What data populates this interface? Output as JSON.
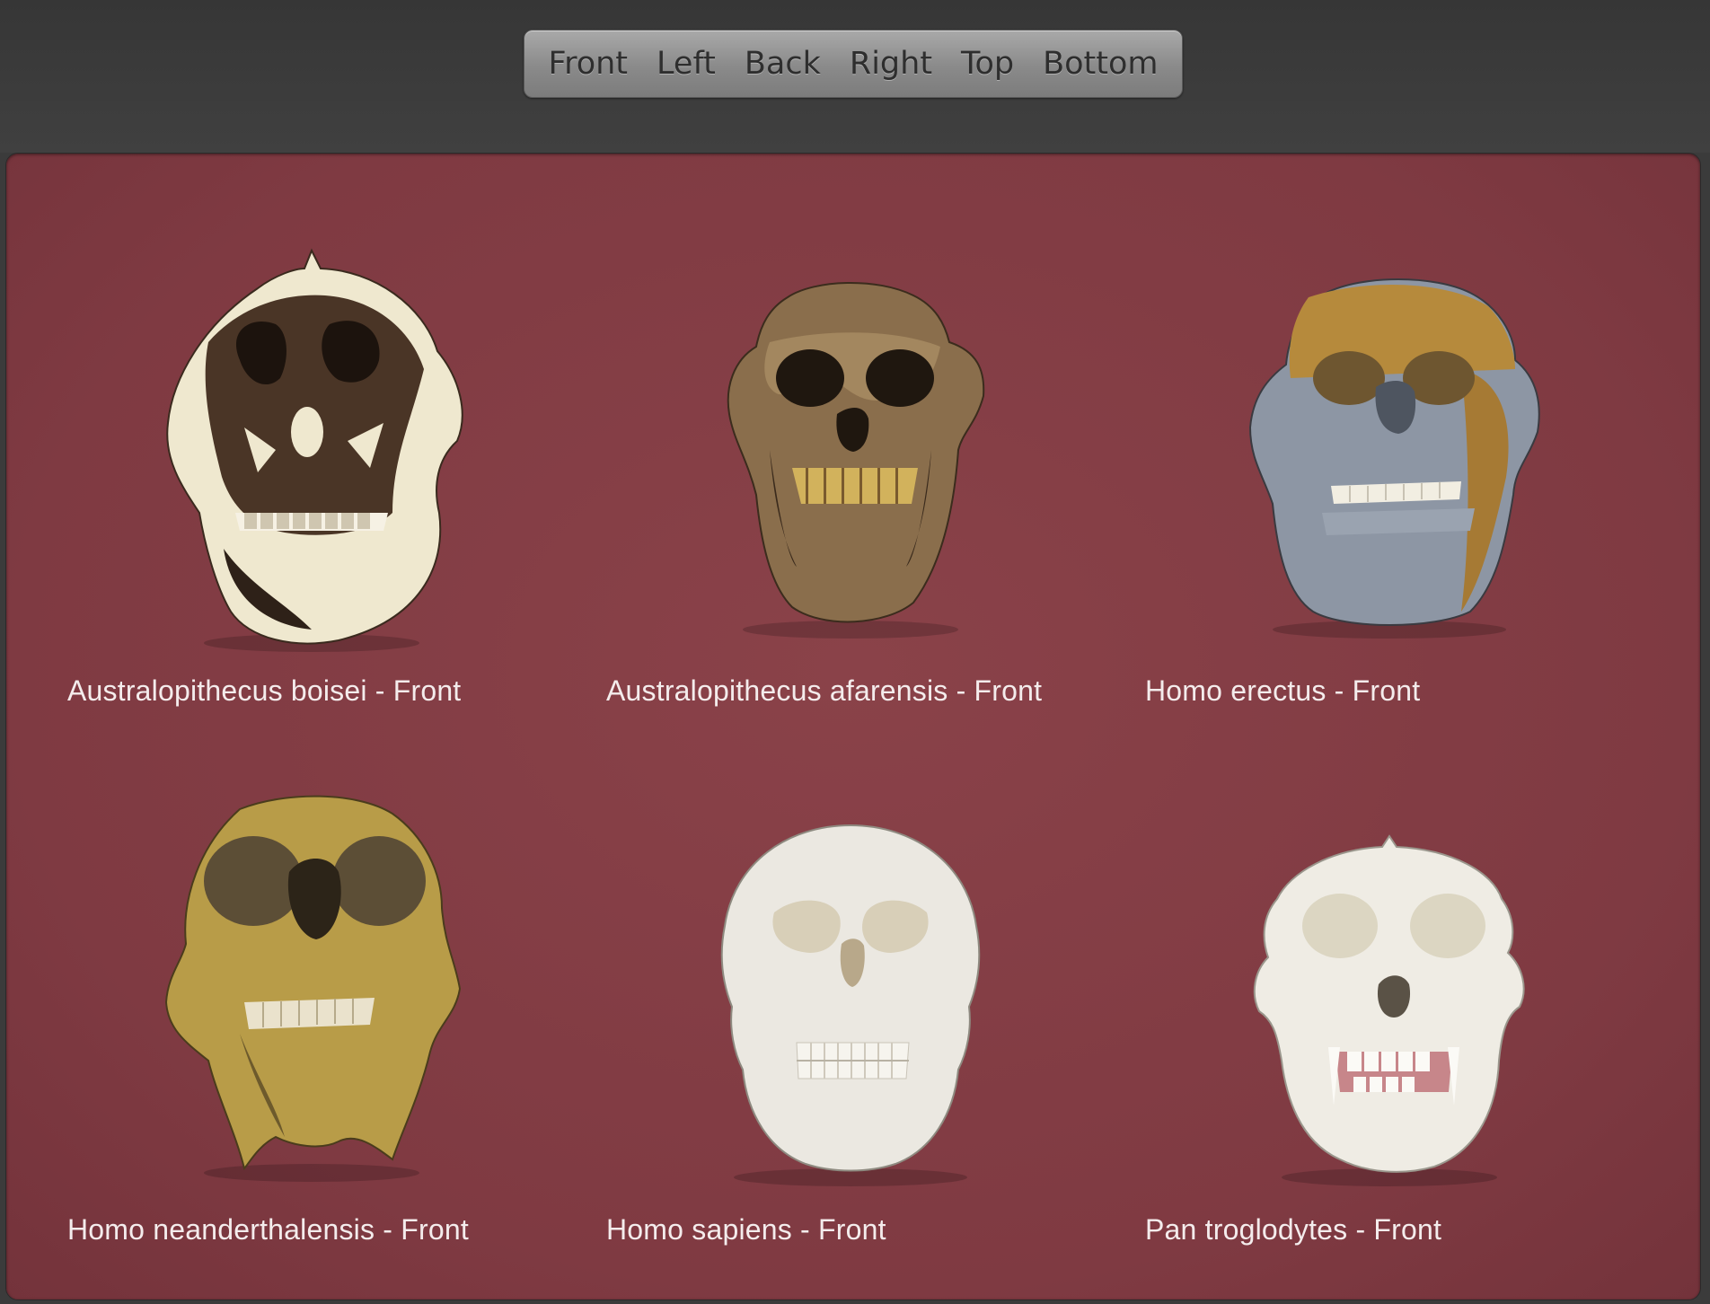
{
  "toolbar": {
    "views": [
      "Front",
      "Left",
      "Back",
      "Right",
      "Top",
      "Bottom"
    ]
  },
  "colors": {
    "panel": "#7f3a42",
    "topbar": "#3b3b3b",
    "caption": "#f4ecec"
  },
  "gallery": {
    "items": [
      {
        "caption": "Australopithecus boisei - Front",
        "icon": "skull-image"
      },
      {
        "caption": "Australopithecus afarensis - Front",
        "icon": "skull-image"
      },
      {
        "caption": "Homo erectus - Front",
        "icon": "skull-image"
      },
      {
        "caption": "Homo neanderthalensis - Front",
        "icon": "skull-image"
      },
      {
        "caption": "Homo sapiens - Front",
        "icon": "skull-image"
      },
      {
        "caption": "Pan troglodytes - Front",
        "icon": "skull-image"
      }
    ]
  }
}
